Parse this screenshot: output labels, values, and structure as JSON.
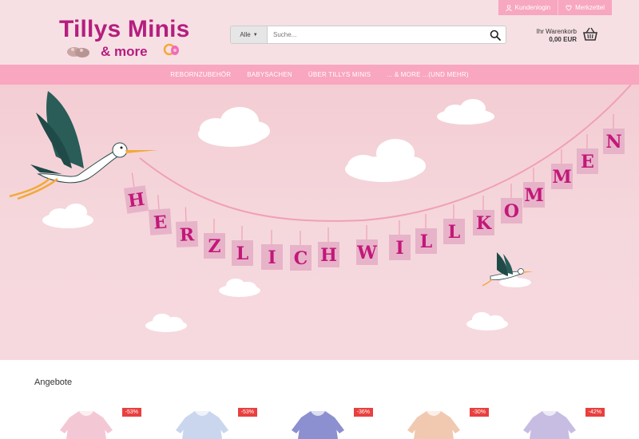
{
  "topbar": {
    "login_label": "Kundenlogin",
    "wishlist_label": "Merkzettel"
  },
  "logo": {
    "title": "Tillys Minis",
    "subtitle": "& more"
  },
  "search": {
    "category": "Alle",
    "placeholder": "Suche..."
  },
  "cart": {
    "label": "Ihr Warenkorb",
    "amount": "0,00 EUR"
  },
  "nav": {
    "items": [
      {
        "label": "REBORNZUBEHÖR"
      },
      {
        "label": "BABYSACHEN"
      },
      {
        "label": "ÜBER TILLYS MINIS"
      },
      {
        "label": "... & MORE ...(UND MEHR)"
      }
    ]
  },
  "hero": {
    "banner_letters": [
      "H",
      "E",
      "R",
      "Z",
      "L",
      "I",
      "C",
      "H",
      "W",
      "I",
      "L",
      "L",
      "K",
      "O",
      "M",
      "M",
      "E",
      "N"
    ]
  },
  "offers": {
    "title": "Angebote",
    "products": [
      {
        "discount": "-53%",
        "color": "#f3c8d4"
      },
      {
        "discount": "-53%",
        "color": "#c9d6ee"
      },
      {
        "discount": "-36%",
        "color": "#8c8fd0"
      },
      {
        "discount": "-30%",
        "color": "#f0c9b0"
      },
      {
        "discount": "-42%",
        "color": "#c7bde3"
      }
    ]
  },
  "colors": {
    "brand": "#b51e7e",
    "nav": "#f9a6c0",
    "badge": "#e8403f"
  }
}
